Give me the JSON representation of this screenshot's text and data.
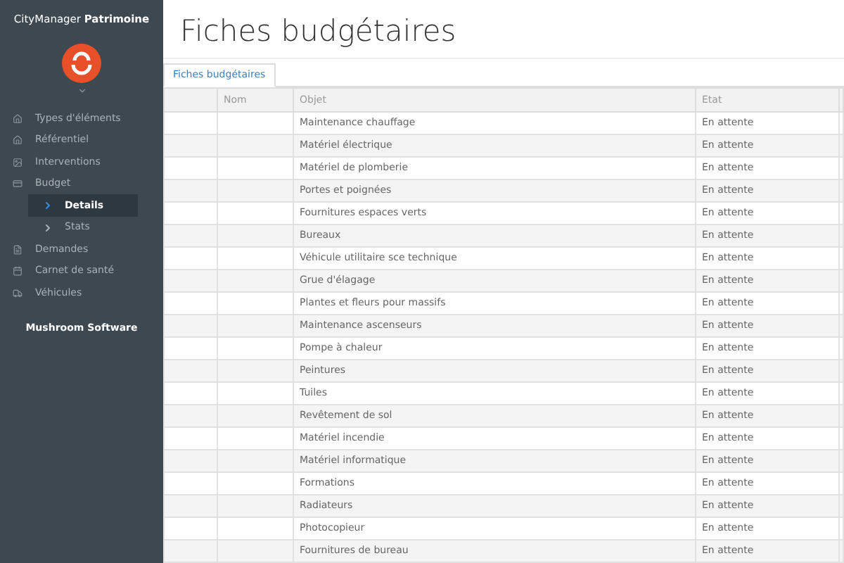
{
  "sidebar": {
    "brand": "CityManager",
    "brand_bold": "Patrimoine",
    "items": [
      {
        "label": "Types d'éléments"
      },
      {
        "label": "Référentiel"
      },
      {
        "label": "Interventions"
      },
      {
        "label": "Budget",
        "children": [
          {
            "label": "Details",
            "selected": true
          },
          {
            "label": "Stats",
            "selected": false
          }
        ]
      },
      {
        "label": "Demandes"
      },
      {
        "label": "Carnet de santé"
      },
      {
        "label": "Véhicules"
      }
    ],
    "footer": "Mushroom Software"
  },
  "page": {
    "title": "Fiches budgétaires",
    "tabs": [
      {
        "label": "Fiches budgétaires",
        "selected": true
      }
    ]
  },
  "table": {
    "columns": [
      "",
      "Nom",
      "Objet",
      "Etat"
    ],
    "rows": [
      {
        "objet": "Maintenance chauffage",
        "etat": "En attente"
      },
      {
        "objet": "Matériel électrique",
        "etat": "En attente"
      },
      {
        "objet": "Matériel de plomberie",
        "etat": "En attente"
      },
      {
        "objet": "Portes et poignées",
        "etat": "En attente"
      },
      {
        "objet": "Fournitures espaces verts",
        "etat": "En attente"
      },
      {
        "objet": "Bureaux",
        "etat": "En attente"
      },
      {
        "objet": "Véhicule utilitaire sce technique",
        "etat": "En attente"
      },
      {
        "objet": "Grue d'élagage",
        "etat": "En attente"
      },
      {
        "objet": "Plantes et fleurs pour massifs",
        "etat": "En attente"
      },
      {
        "objet": "Maintenance ascenseurs",
        "etat": "En attente"
      },
      {
        "objet": "Pompe à chaleur",
        "etat": "En attente"
      },
      {
        "objet": "Peintures",
        "etat": "En attente"
      },
      {
        "objet": "Tuiles",
        "etat": "En attente"
      },
      {
        "objet": "Revêtement de sol",
        "etat": "En attente"
      },
      {
        "objet": "Matériel incendie",
        "etat": "En attente"
      },
      {
        "objet": "Matériel informatique",
        "etat": "En attente"
      },
      {
        "objet": "Formations",
        "etat": "En attente"
      },
      {
        "objet": "Radiateurs",
        "etat": "En attente"
      },
      {
        "objet": "Photocopieur",
        "etat": "En attente"
      },
      {
        "objet": "Fournitures de bureau",
        "etat": "En attente"
      }
    ]
  }
}
